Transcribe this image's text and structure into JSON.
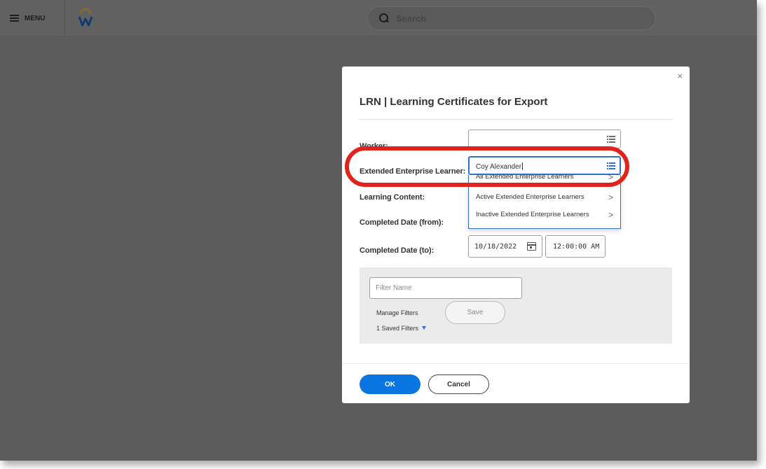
{
  "topbar": {
    "menu_label": "MENU",
    "logo_icon": "workday-logo-icon",
    "search_placeholder": "Search"
  },
  "modal": {
    "title": "LRN | Learning Certificates for Export",
    "close_glyph": "×",
    "fields": {
      "worker_label": "Worker:",
      "ee_label": "Extended Enterprise Learner:",
      "ee_value": "Coy Alexander",
      "learning_content_label": "Learning Content:",
      "completed_from_label": "Completed Date (from):",
      "completed_to_label": "Completed Date (to):",
      "completed_to_date": "10/18/2022",
      "completed_to_time": "12:00:00 AM"
    },
    "dropdown": {
      "items": [
        {
          "label": "All Extended Enterprise Learners",
          "chevron": ">"
        },
        {
          "label": "Active Extended Enterprise Learners",
          "chevron": ">"
        },
        {
          "label": "Inactive Extended Enterprise Learners",
          "chevron": ">"
        }
      ]
    },
    "filters": {
      "filter_name_placeholder": "Filter Name",
      "manage_label": "Manage Filters",
      "saved_label": "1 Saved Filters",
      "save_label": "Save"
    },
    "ok_label": "OK",
    "cancel_label": "Cancel"
  },
  "colors": {
    "accent": "#0875e1",
    "highlight": "#e0241c",
    "overlay": "#5c5c5c"
  }
}
